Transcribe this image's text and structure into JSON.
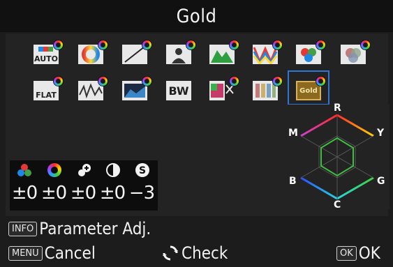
{
  "title": "Gold",
  "presets": [
    {
      "name": "Auto",
      "label": "AUTO",
      "icon": "auto-preset-icon"
    },
    {
      "name": "Natural",
      "label": "",
      "icon": "natural-preset-icon"
    },
    {
      "name": "Bright",
      "label": "",
      "icon": "bright-preset-icon"
    },
    {
      "name": "Portrait",
      "label": "",
      "icon": "portrait-preset-icon"
    },
    {
      "name": "Landscape",
      "label": "",
      "icon": "landscape-preset-icon"
    },
    {
      "name": "Vibrant",
      "label": "",
      "icon": "vibrant-preset-icon"
    },
    {
      "name": "Radiant",
      "label": "",
      "icon": "radiant-preset-icon"
    },
    {
      "name": "Muted",
      "label": "",
      "icon": "muted-preset-icon"
    },
    {
      "name": "Flat",
      "label": "FLAT",
      "icon": "flat-preset-icon"
    },
    {
      "name": "Bleach Bypass",
      "label": "",
      "icon": "bleach-bypass-preset-icon"
    },
    {
      "name": "Reversal Film",
      "label": "",
      "icon": "reversal-film-preset-icon"
    },
    {
      "name": "Monochrome",
      "label": "BW",
      "icon": "monochrome-preset-icon"
    },
    {
      "name": "Cross Processing",
      "label": "",
      "icon": "cross-processing-preset-icon"
    },
    {
      "name": "Fade",
      "label": "",
      "icon": "fade-preset-icon"
    },
    {
      "name": "Gold",
      "label": "Gold",
      "icon": "gold-preset-icon",
      "selected": true
    }
  ],
  "adjustments": [
    {
      "name": "saturation",
      "icon": "saturation-icon",
      "value": "±0"
    },
    {
      "name": "hue",
      "icon": "hue-icon",
      "value": "±0"
    },
    {
      "name": "high-low-key",
      "icon": "high-low-key-icon",
      "value": "±0"
    },
    {
      "name": "contrast",
      "icon": "contrast-icon",
      "value": "±0"
    },
    {
      "name": "sharpness",
      "icon": "sharpness-icon",
      "value": "−3"
    }
  ],
  "hexagon": {
    "labels": {
      "top": "R",
      "top_right": "Y",
      "bottom_right": "G",
      "bottom": "C",
      "bottom_left": "B",
      "top_left": "M"
    }
  },
  "footer": {
    "info_key": "INFO",
    "info_text": "Parameter Adj.",
    "menu_key": "MENU",
    "menu_text": "Cancel",
    "check_icon": "rotate-dial-icon",
    "check_text": "Check",
    "ok_key": "OK",
    "ok_text": "OK"
  },
  "colors": {
    "selection_border": "#2f76d8",
    "background": "#1c1c1c"
  }
}
